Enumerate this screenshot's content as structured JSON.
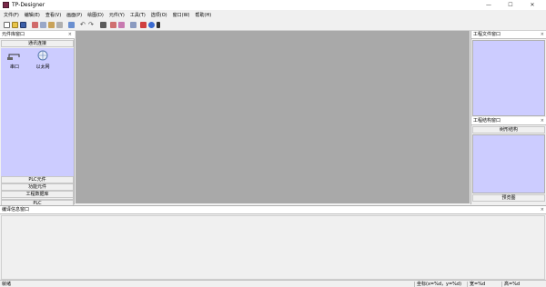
{
  "window": {
    "title": "TP-Designer"
  },
  "menu": [
    "文件(F)",
    "编辑(E)",
    "查看(V)",
    "画面(P)",
    "绘图(D)",
    "元件(Y)",
    "工具(T)",
    "选项(O)",
    "窗口(W)",
    "帮助(H)"
  ],
  "toolbar_icons": [
    "new-file-icon",
    "open-folder-icon",
    "save-icon",
    "save-all-icon",
    "cut-icon",
    "copy-icon",
    "paste-icon",
    "delete-icon",
    "undo-icon",
    "redo-icon",
    "find-icon",
    "compile-icon",
    "download-icon",
    "upload-icon",
    "simulate-icon",
    "help-icon",
    "info-icon"
  ],
  "left_panel": {
    "title": "元件库窗口",
    "close": "×",
    "top_category": "通讯连接",
    "components": [
      {
        "label": "串口",
        "icon": "serial-port-icon"
      },
      {
        "label": "以太网",
        "icon": "ethernet-icon"
      }
    ],
    "categories": [
      "HMI",
      "PLC",
      "PLC元件",
      "功能元件",
      "工程数据库"
    ]
  },
  "right_panel": {
    "file_window_title": "工程文件窗口",
    "structure_window_title": "工程结构窗口",
    "tree_tab": "树形结构",
    "preview_tab": "预览图",
    "close": "×"
  },
  "bottom_panel": {
    "title": "编译信息窗口",
    "close": "×"
  },
  "status": {
    "ready": "就绪",
    "coords": "坐标(x=%d，y=%d)",
    "width": "宽=%d",
    "height": "高=%d"
  },
  "colors": {
    "panel_fill": "#ccccff",
    "canvas": "#a9a9a9"
  }
}
